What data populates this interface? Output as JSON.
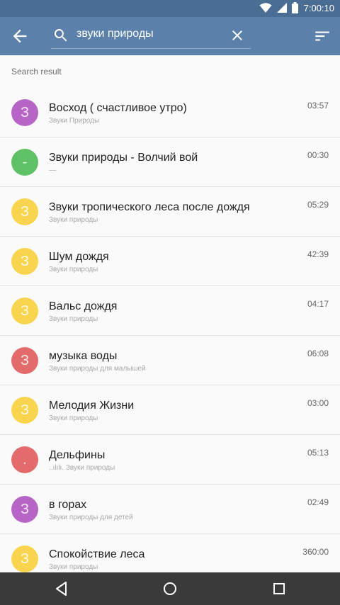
{
  "status_bar": {
    "time": "7:00:10"
  },
  "search": {
    "query": "звуки природы"
  },
  "section_label": "Search result",
  "colors": {
    "purple": "#b665c6",
    "green": "#5fc165",
    "yellow": "#f9d44f",
    "red": "#e46b6b"
  },
  "tracks": [
    {
      "avatar": "З",
      "color": "#b665c6",
      "title": "Восход ( счастливое утро)",
      "subtitle": "Звуки Природы",
      "duration": "03:57"
    },
    {
      "avatar": "-",
      "color": "#5fc165",
      "title": "Звуки природы - Волчий вой",
      "subtitle": "—",
      "duration": "00:30"
    },
    {
      "avatar": "З",
      "color": "#f9d44f",
      "title": "Звуки тропического леса после дождя",
      "subtitle": "Звуки природы",
      "duration": "05:29"
    },
    {
      "avatar": "З",
      "color": "#f9d44f",
      "title": "Шум дождя",
      "subtitle": "Звуки природы",
      "duration": "42:39"
    },
    {
      "avatar": "З",
      "color": "#f9d44f",
      "title": "Вальс дождя",
      "subtitle": "Звуки природы",
      "duration": "04:17"
    },
    {
      "avatar": "З",
      "color": "#e46b6b",
      "title": "музыка воды",
      "subtitle": "Звуки природы для малышей",
      "duration": "06:08"
    },
    {
      "avatar": "З",
      "color": "#f9d44f",
      "title": "Мелодия Жизни",
      "subtitle": "Звуки природы",
      "duration": "03:00"
    },
    {
      "avatar": ".",
      "color": "#e46b6b",
      "title": "Дельфины",
      "subtitle": "..ılılı. Звуки природы",
      "duration": "05:13"
    },
    {
      "avatar": "З",
      "color": "#b665c6",
      "title": "в горах",
      "subtitle": "Звуки природы для детей",
      "duration": "02:49"
    },
    {
      "avatar": "З",
      "color": "#f9d44f",
      "title": "Спокойствие леса",
      "subtitle": "Звуки природы",
      "duration": "360:00"
    }
  ]
}
